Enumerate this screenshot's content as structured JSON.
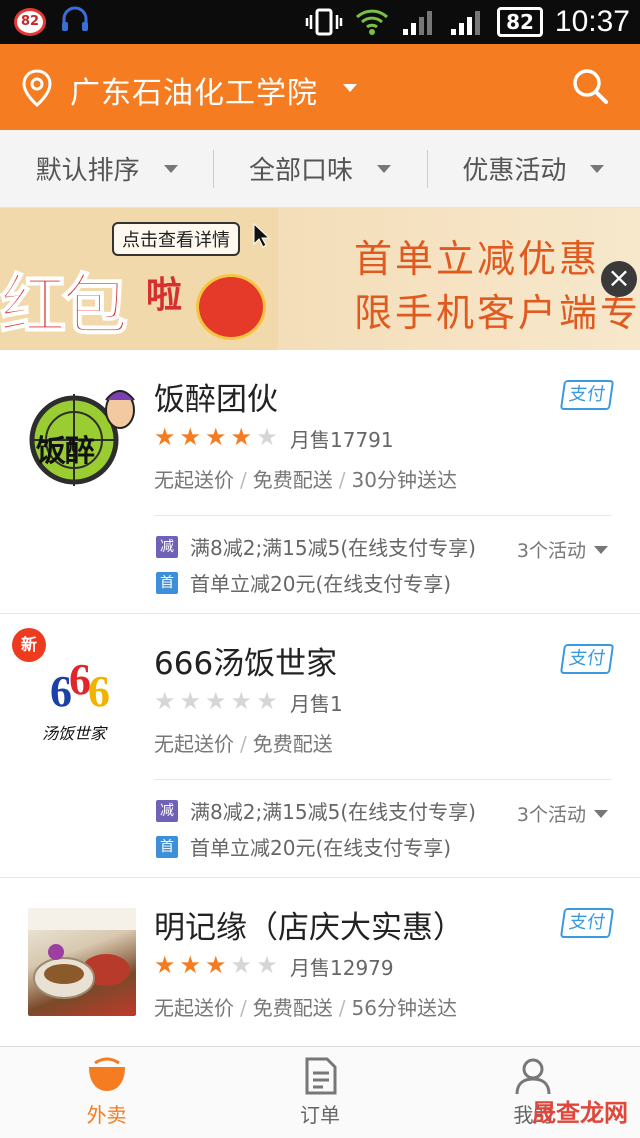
{
  "status_bar": {
    "badge": "82",
    "battery": "82",
    "time": "10:37"
  },
  "header": {
    "location": "广东石油化工学院",
    "accent": "#f57c20"
  },
  "filters": [
    {
      "label": "默认排序"
    },
    {
      "label": "全部口味"
    },
    {
      "label": "优惠活动"
    }
  ],
  "banner": {
    "bubble": "点击查看详情",
    "big_text": "红包",
    "small_text": "啦",
    "line1": "首单立减优惠",
    "line2": "限手机客户端专"
  },
  "shops": [
    {
      "name": "饭醉团伙",
      "logo_text": "饭醉",
      "pay": "支付",
      "rating_of_5": 4,
      "sales": "月售17791",
      "delivery": [
        "无起送价",
        "免费配送",
        "30分钟送达"
      ],
      "promos": [
        {
          "tag": "减",
          "text": "满8减2;满15减5(在线支付专享)"
        },
        {
          "tag": "首",
          "text": "首单立减20元(在线支付专享)"
        }
      ],
      "activity": "3个活动"
    },
    {
      "name": "666汤饭世家",
      "logo_text": "666",
      "logo_sub": "汤饭世家",
      "new": "新",
      "pay": "支付",
      "rating_of_5": 0,
      "sales": "月售1",
      "delivery": [
        "无起送价",
        "免费配送"
      ],
      "promos": [
        {
          "tag": "减",
          "text": "满8减2;满15减5(在线支付专享)"
        },
        {
          "tag": "首",
          "text": "首单立减20元(在线支付专享)"
        }
      ],
      "activity": "3个活动"
    },
    {
      "name": "明记缘（店庆大实惠）",
      "pay": "支付",
      "rating_of_5": 3,
      "sales": "月售12979",
      "delivery": [
        "无起送价",
        "免费配送",
        "56分钟送达"
      ]
    }
  ],
  "bottom_nav": [
    {
      "label": "外卖",
      "icon": "bowl-icon"
    },
    {
      "label": "订单",
      "icon": "order-list-icon"
    },
    {
      "label": "我的",
      "icon": "profile-icon"
    }
  ],
  "watermark": "晟查龙网"
}
